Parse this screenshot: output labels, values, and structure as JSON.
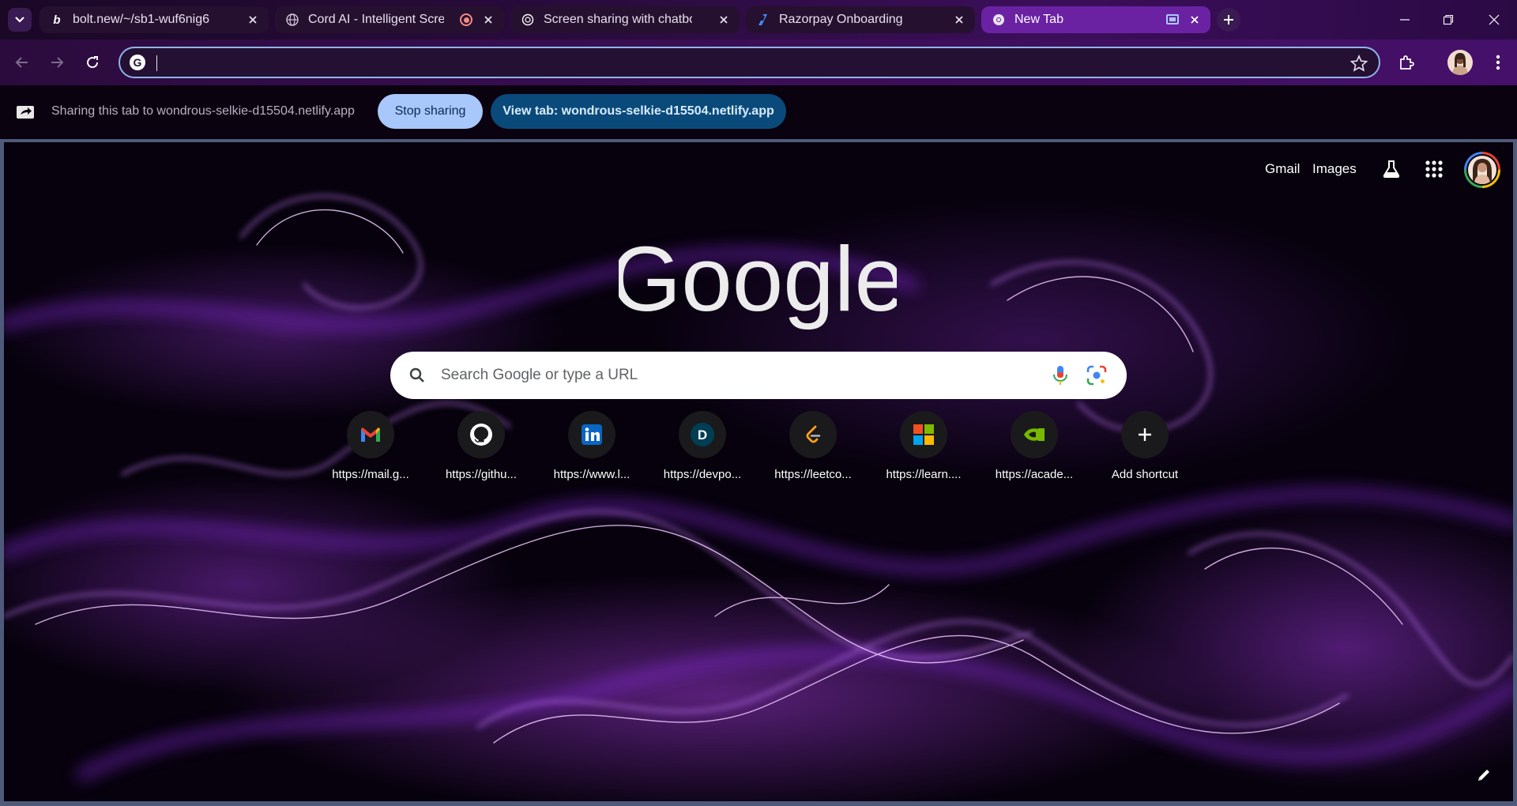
{
  "tabs": [
    {
      "title": "bolt.new/~/sb1-wuf6nig6",
      "favicon": "bolt-b-icon",
      "active": false
    },
    {
      "title": "Cord AI - Intelligent Screen",
      "favicon": "globe-icon",
      "recording": true,
      "active": false
    },
    {
      "title": "Screen sharing with chatbot",
      "favicon": "chatgpt-icon",
      "active": false
    },
    {
      "title": "Razorpay Onboarding",
      "favicon": "razorpay-icon",
      "active": false
    },
    {
      "title": "New Tab",
      "favicon": "chrome-icon",
      "sharing_indicator": true,
      "active": true
    }
  ],
  "omnibox": {
    "value": "",
    "placeholder": ""
  },
  "sharing_bar": {
    "message": "Sharing this tab to wondrous-selkie-d15504.netlify.app",
    "stop_label": "Stop sharing",
    "view_label": "View tab: wondrous-selkie-d15504.netlify.app"
  },
  "ntp": {
    "top_links": {
      "gmail": "Gmail",
      "images": "Images"
    },
    "logo_text": "Google",
    "search_placeholder": "Search Google or type a URL",
    "shortcuts": [
      {
        "label": "https://mail.g...",
        "icon": "gmail-icon"
      },
      {
        "label": "https://githu...",
        "icon": "github-icon"
      },
      {
        "label": "https://www.l...",
        "icon": "linkedin-icon"
      },
      {
        "label": "https://devpo...",
        "icon": "devpost-icon"
      },
      {
        "label": "https://leetco...",
        "icon": "leetcode-icon"
      },
      {
        "label": "https://learn....",
        "icon": "microsoft-icon"
      },
      {
        "label": "https://acade...",
        "icon": "nvidia-icon"
      },
      {
        "label": "Add shortcut",
        "icon": "plus-icon"
      }
    ]
  },
  "colors": {
    "accent": "#a8c7fa",
    "active_tab": "#6a22a3",
    "view_button": "#0a4a7a"
  }
}
